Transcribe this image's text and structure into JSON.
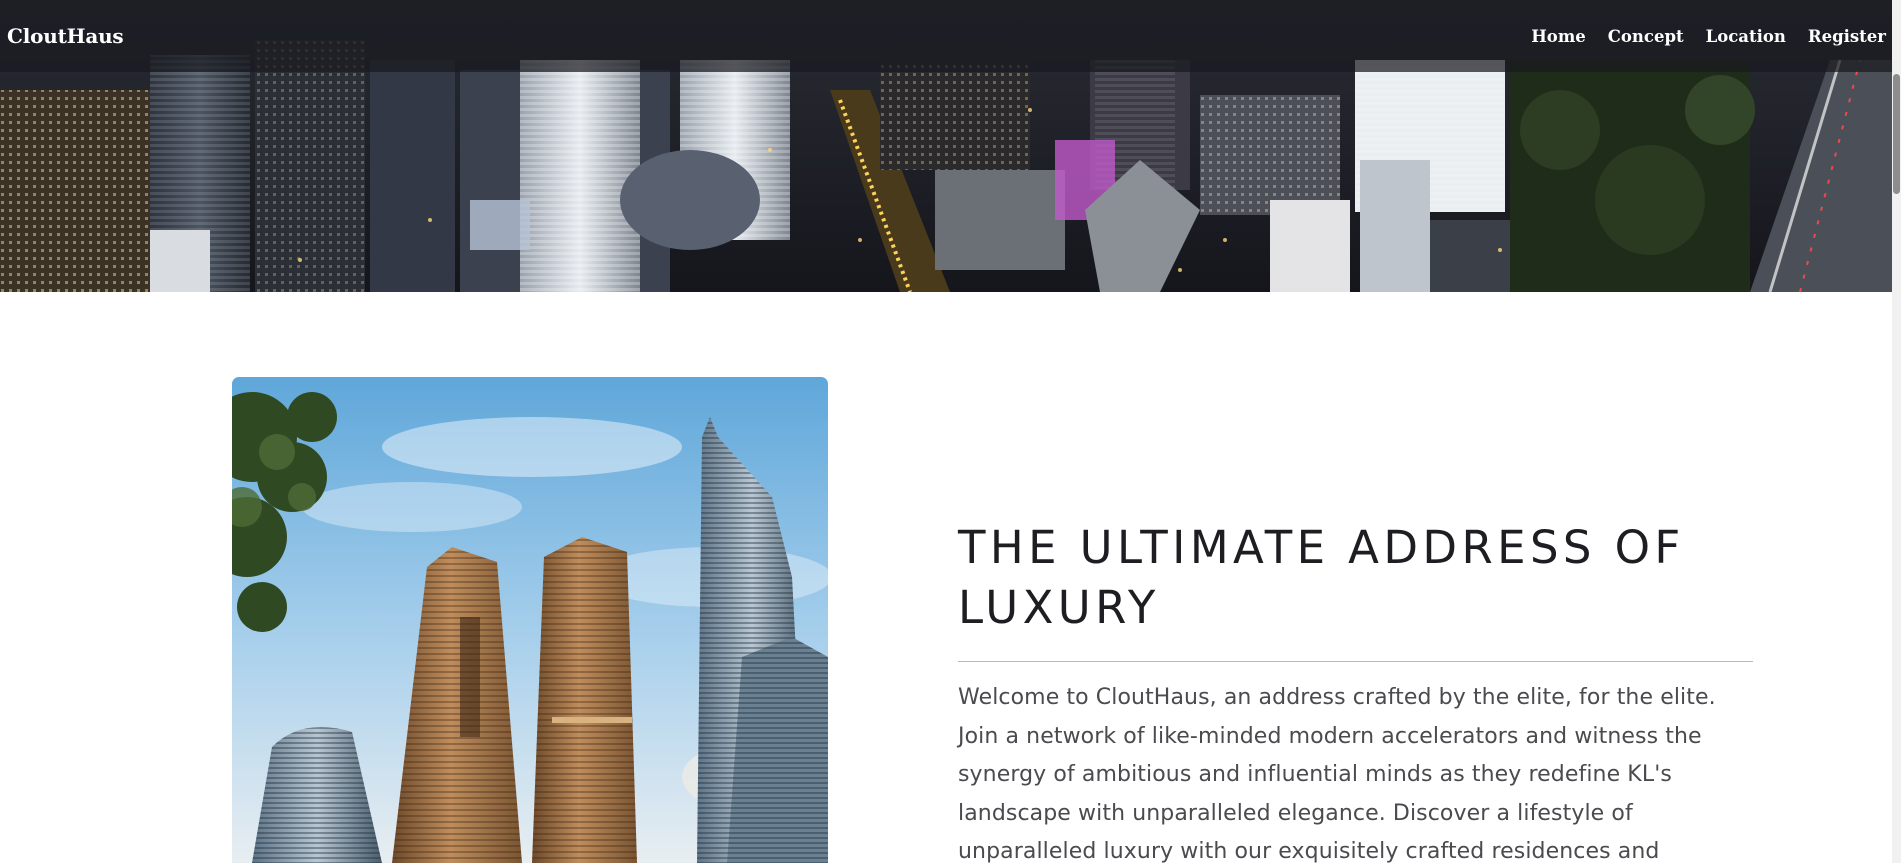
{
  "navbar": {
    "brand": "CloutHaus",
    "links": [
      "Home",
      "Concept",
      "Location",
      "Register"
    ]
  },
  "hero": {
    "image": "aerial night view of Kuala Lumpur city centre skyline"
  },
  "feature": {
    "image": "two bronze towers beside the Petronas Towers under blue sky"
  },
  "main": {
    "heading": "THE ULTIMATE ADDRESS OF LUXURY",
    "intro": "Welcome to CloutHaus, an address crafted by the elite, for the elite. Join a network of like-minded modern accelerators and witness the synergy of ambitious and influential minds as they redefine KL's landscape with unparalleled elegance. Discover a lifestyle of unparalleled luxury with our exquisitely crafted residences and"
  },
  "colors": {
    "navbar_bg": "#191a20",
    "heading": "#1e1e22",
    "body_text": "#4a4a4f",
    "divider": "#b9b9b9"
  }
}
